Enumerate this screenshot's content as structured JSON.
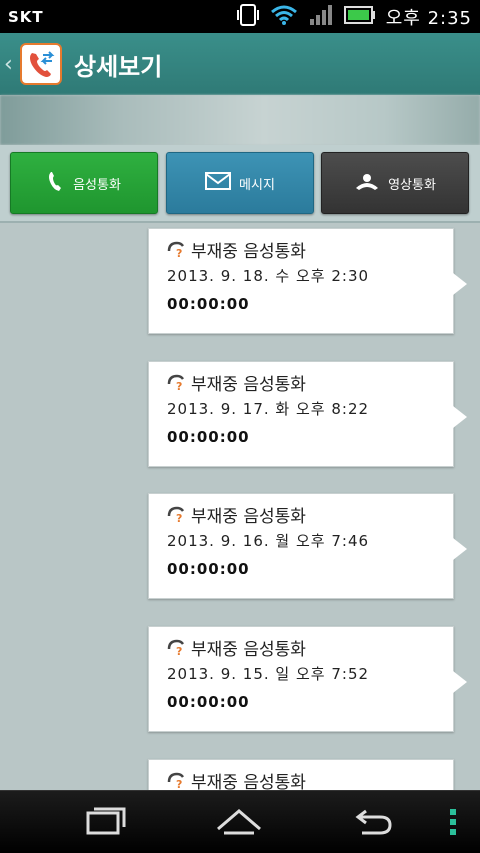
{
  "status_bar": {
    "carrier": "SKT",
    "time": "오후 2:35",
    "icons": [
      "vibrate-phone-icon",
      "wifi-icon",
      "signal-icon",
      "battery-icon"
    ]
  },
  "header": {
    "title": "상세보기",
    "back_icon": "chevron-left-icon",
    "app_icon": "call-log-icon"
  },
  "actions": {
    "voice_call": "음성통화",
    "message": "메시지",
    "video_call": "영상통화"
  },
  "logs": [
    {
      "title": "부재중 음성통화",
      "date": "2013. 9. 18. 수 오후 2:30",
      "duration": "00:00:00"
    },
    {
      "title": "부재중 음성통화",
      "date": "2013. 9. 17. 화 오후 8:22",
      "duration": "00:00:00"
    },
    {
      "title": "부재중 음성통화",
      "date": "2013. 9. 16. 월 오후 7:46",
      "duration": "00:00:00"
    },
    {
      "title": "부재중 음성통화",
      "date": "2013. 9. 15. 일 오후 7:52",
      "duration": "00:00:00"
    },
    {
      "title": "부재중 음성통화",
      "date": "",
      "duration": ""
    }
  ],
  "nav": {
    "icons": [
      "recent-apps-icon",
      "home-icon",
      "back-icon",
      "menu-icon"
    ]
  },
  "colors": {
    "header": "#2f7a76",
    "call_button": "#1f962f",
    "message_button": "#2b7b9c",
    "video_button": "#333333",
    "background": "#b9c6c6"
  }
}
